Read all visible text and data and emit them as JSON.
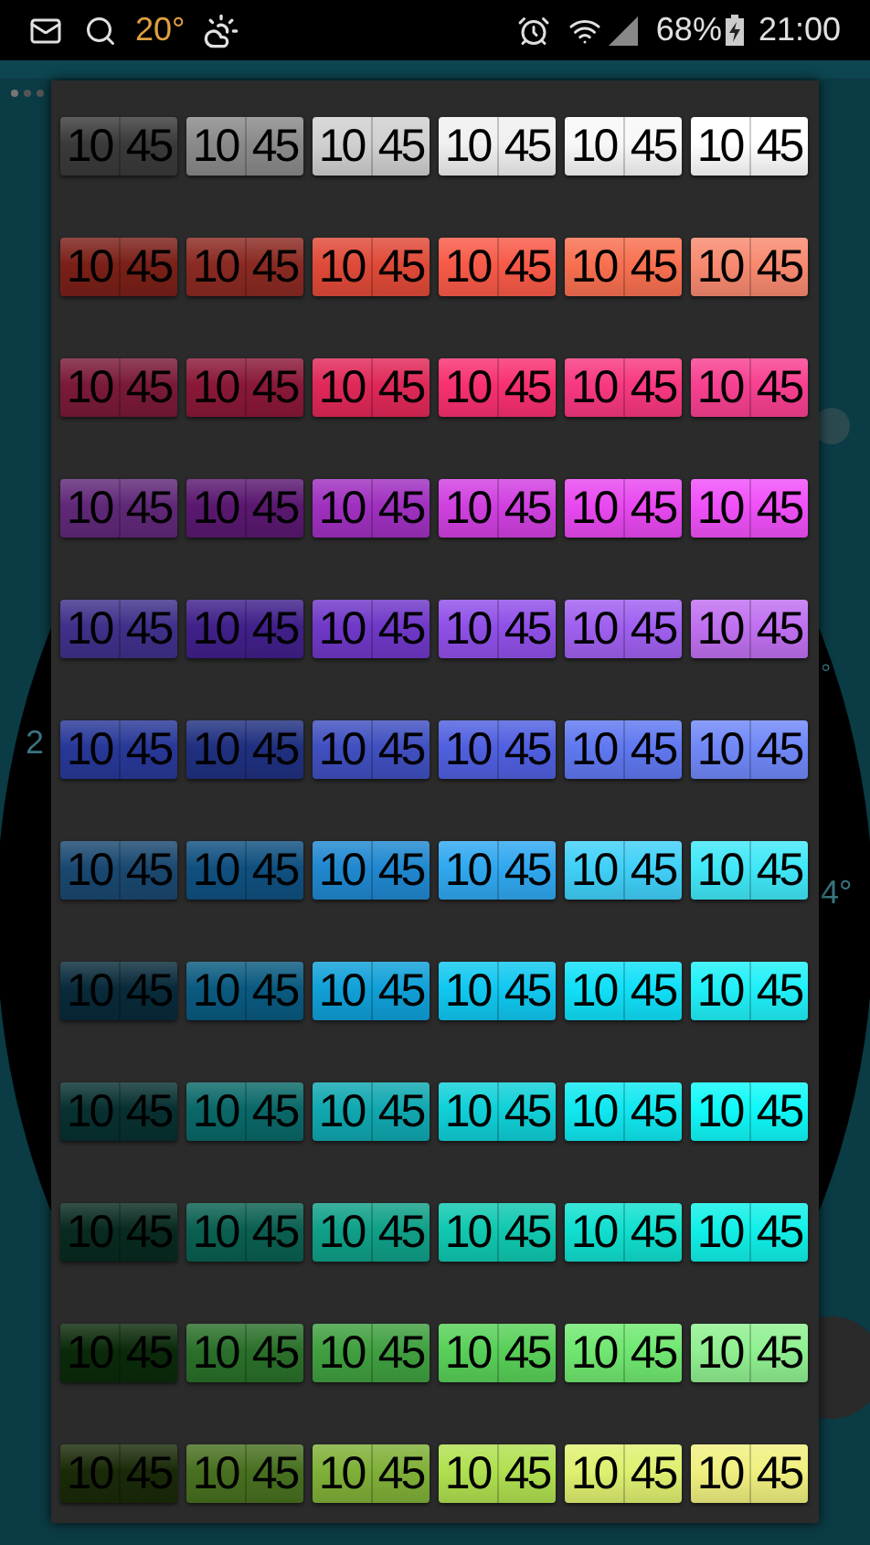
{
  "status_bar": {
    "temperature": "20°",
    "battery": "68%",
    "time": "21:00"
  },
  "background": {
    "left_label": "2",
    "right_label": "4°",
    "right_mark": "°"
  },
  "color_grid": {
    "rows": [
      {
        "tiles": [
          {
            "hours": "10",
            "minutes": "45",
            "color": "#3a3a3a"
          },
          {
            "hours": "10",
            "minutes": "45",
            "color": "#8a8a8a"
          },
          {
            "hours": "10",
            "minutes": "45",
            "color": "#d0d0d0"
          },
          {
            "hours": "10",
            "minutes": "45",
            "color": "#f0f0f0"
          },
          {
            "hours": "10",
            "minutes": "45",
            "color": "#f8f8f8"
          },
          {
            "hours": "10",
            "minutes": "45",
            "color": "#ffffff"
          }
        ]
      },
      {
        "tiles": [
          {
            "hours": "10",
            "minutes": "45",
            "color": "#7a2018"
          },
          {
            "hours": "10",
            "minutes": "45",
            "color": "#8a2a22"
          },
          {
            "hours": "10",
            "minutes": "45",
            "color": "#e04a38"
          },
          {
            "hours": "10",
            "minutes": "45",
            "color": "#f85a48"
          },
          {
            "hours": "10",
            "minutes": "45",
            "color": "#f87050"
          },
          {
            "hours": "10",
            "minutes": "45",
            "color": "#f88a70"
          }
        ]
      },
      {
        "tiles": [
          {
            "hours": "10",
            "minutes": "45",
            "color": "#7a1a38"
          },
          {
            "hours": "10",
            "minutes": "45",
            "color": "#8a1838"
          },
          {
            "hours": "10",
            "minutes": "45",
            "color": "#e02858"
          },
          {
            "hours": "10",
            "minutes": "45",
            "color": "#f83070"
          },
          {
            "hours": "10",
            "minutes": "45",
            "color": "#f83880"
          },
          {
            "hours": "10",
            "minutes": "45",
            "color": "#f84090"
          }
        ]
      },
      {
        "tiles": [
          {
            "hours": "10",
            "minutes": "45",
            "color": "#602878"
          },
          {
            "hours": "10",
            "minutes": "45",
            "color": "#5a1870"
          },
          {
            "hours": "10",
            "minutes": "45",
            "color": "#a030c0"
          },
          {
            "hours": "10",
            "minutes": "45",
            "color": "#d040e0"
          },
          {
            "hours": "10",
            "minutes": "45",
            "color": "#e848f0"
          },
          {
            "hours": "10",
            "minutes": "45",
            "color": "#f050f8"
          }
        ]
      },
      {
        "tiles": [
          {
            "hours": "10",
            "minutes": "45",
            "color": "#40308a"
          },
          {
            "hours": "10",
            "minutes": "45",
            "color": "#40208a"
          },
          {
            "hours": "10",
            "minutes": "45",
            "color": "#7038c8"
          },
          {
            "hours": "10",
            "minutes": "45",
            "color": "#9050e8"
          },
          {
            "hours": "10",
            "minutes": "45",
            "color": "#a060f0"
          },
          {
            "hours": "10",
            "minutes": "45",
            "color": "#c070f0"
          }
        ]
      },
      {
        "tiles": [
          {
            "hours": "10",
            "minutes": "45",
            "color": "#283898"
          },
          {
            "hours": "10",
            "minutes": "45",
            "color": "#203080"
          },
          {
            "hours": "10",
            "minutes": "45",
            "color": "#4050c0"
          },
          {
            "hours": "10",
            "minutes": "45",
            "color": "#5060e0"
          },
          {
            "hours": "10",
            "minutes": "45",
            "color": "#6078f0"
          },
          {
            "hours": "10",
            "minutes": "45",
            "color": "#7088f8"
          }
        ]
      },
      {
        "tiles": [
          {
            "hours": "10",
            "minutes": "45",
            "color": "#1a4870"
          },
          {
            "hours": "10",
            "minutes": "45",
            "color": "#105080"
          },
          {
            "hours": "10",
            "minutes": "45",
            "color": "#2088d0"
          },
          {
            "hours": "10",
            "minutes": "45",
            "color": "#30a8f0"
          },
          {
            "hours": "10",
            "minutes": "45",
            "color": "#40d0f8"
          },
          {
            "hours": "10",
            "minutes": "45",
            "color": "#40e8f8"
          }
        ]
      },
      {
        "tiles": [
          {
            "hours": "10",
            "minutes": "45",
            "color": "#082a3a"
          },
          {
            "hours": "10",
            "minutes": "45",
            "color": "#0a5a80"
          },
          {
            "hours": "10",
            "minutes": "45",
            "color": "#10a0d8"
          },
          {
            "hours": "10",
            "minutes": "45",
            "color": "#10c8f0"
          },
          {
            "hours": "10",
            "minutes": "45",
            "color": "#10e0f8"
          },
          {
            "hours": "10",
            "minutes": "45",
            "color": "#20f0f8"
          }
        ]
      },
      {
        "tiles": [
          {
            "hours": "10",
            "minutes": "45",
            "color": "#083030"
          },
          {
            "hours": "10",
            "minutes": "45",
            "color": "#0a6868"
          },
          {
            "hours": "10",
            "minutes": "45",
            "color": "#10a8b0"
          },
          {
            "hours": "10",
            "minutes": "45",
            "color": "#10d0d8"
          },
          {
            "hours": "10",
            "minutes": "45",
            "color": "#10e8f0"
          },
          {
            "hours": "10",
            "minutes": "45",
            "color": "#10f8f8"
          }
        ]
      },
      {
        "tiles": [
          {
            "hours": "10",
            "minutes": "45",
            "color": "#082a20"
          },
          {
            "hours": "10",
            "minutes": "45",
            "color": "#0a6050"
          },
          {
            "hours": "10",
            "minutes": "45",
            "color": "#10a088"
          },
          {
            "hours": "10",
            "minutes": "45",
            "color": "#10c8b0"
          },
          {
            "hours": "10",
            "minutes": "45",
            "color": "#10e0d0"
          },
          {
            "hours": "10",
            "minutes": "45",
            "color": "#10f0e8"
          }
        ]
      },
      {
        "tiles": [
          {
            "hours": "10",
            "minutes": "45",
            "color": "#0a2a0a"
          },
          {
            "hours": "10",
            "minutes": "45",
            "color": "#2a702a"
          },
          {
            "hours": "10",
            "minutes": "45",
            "color": "#40a040"
          },
          {
            "hours": "10",
            "minutes": "45",
            "color": "#58d058"
          },
          {
            "hours": "10",
            "minutes": "45",
            "color": "#70e870"
          },
          {
            "hours": "10",
            "minutes": "45",
            "color": "#90f090"
          }
        ]
      },
      {
        "tiles": [
          {
            "hours": "10",
            "minutes": "45",
            "color": "#1a2a08"
          },
          {
            "hours": "10",
            "minutes": "45",
            "color": "#487020"
          },
          {
            "hours": "10",
            "minutes": "45",
            "color": "#80b038"
          },
          {
            "hours": "10",
            "minutes": "45",
            "color": "#b0e050"
          },
          {
            "hours": "10",
            "minutes": "45",
            "color": "#e0f070"
          },
          {
            "hours": "10",
            "minutes": "45",
            "color": "#f0f080"
          }
        ]
      }
    ]
  }
}
